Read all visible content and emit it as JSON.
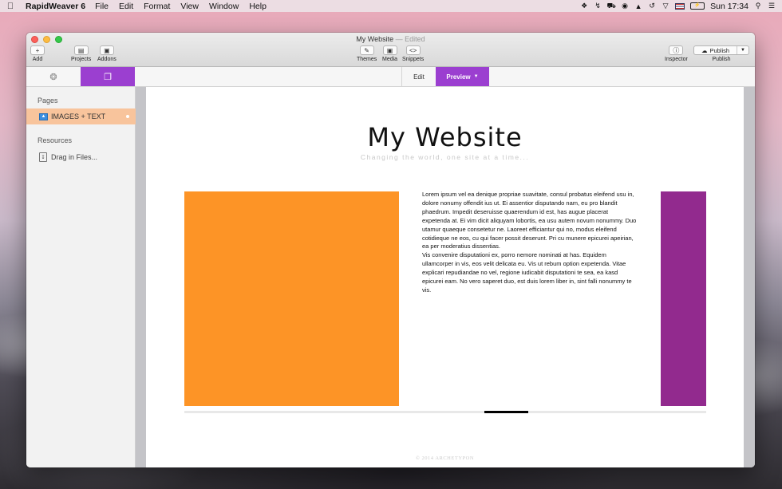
{
  "menubar": {
    "app_name": "RapidWeaver 6",
    "items": [
      "File",
      "Edit",
      "Format",
      "View",
      "Window",
      "Help"
    ],
    "clock": "Sun 17:34"
  },
  "window": {
    "title": "My Website",
    "title_separator": "—",
    "status": "Edited"
  },
  "toolbar": {
    "add_label": "Add",
    "projects_label": "Projects",
    "addons_label": "Addons",
    "themes_label": "Themes",
    "media_label": "Media",
    "snippets_label": "Snippets",
    "inspector_label": "Inspector",
    "publish_button": "Publish",
    "publish_label": "Publish"
  },
  "modebar": {
    "edit_label": "Edit",
    "preview_label": "Preview",
    "accent_color": "#9b3fd0"
  },
  "sidebar": {
    "pages_heading": "Pages",
    "page_item": "IMAGES + TEXT",
    "resources_heading": "Resources",
    "drag_files": "Drag in Files..."
  },
  "site": {
    "title": "My Website",
    "slogan": "Changing the world, one site at a time...",
    "paragraph1": "Lorem ipsum vel ea denique propriae suavitate, consul probatus eleifend usu in, dolore nonumy offendit ius ut. Ei assentior disputando nam, eu pro blandit phaedrum. Impedit deseruisse quaerendum id est, has augue placerat expetenda at. Ei vim dicit aliquyam lobortis, ea usu autem novum nonummy. Duo utamur quaeque consetetur ne. Laoreet efficiantur qui no, modus eleifend cotidieque ne eos, cu qui facer possit deserunt. Pri cu munere epicurei apeirian, ea per moderatius dissentias.",
    "paragraph2": "Vis convenire disputationi ex, porro nemore nominati at has. Equidem ullamcorper in vis, eos velit delicata eu. Vis ut rebum option expetenda. Vitae explicari repudiandae no vel, regione iudicabit disputationi te sea, ea kasd epicurei eam. No vero saperet duo, est duis lorem liber in, sint falli nonummy te vis.",
    "image_colors": {
      "left": "#fd9426",
      "right": "#922a8e"
    },
    "footer": "© 2014 ARCHETYPON"
  }
}
